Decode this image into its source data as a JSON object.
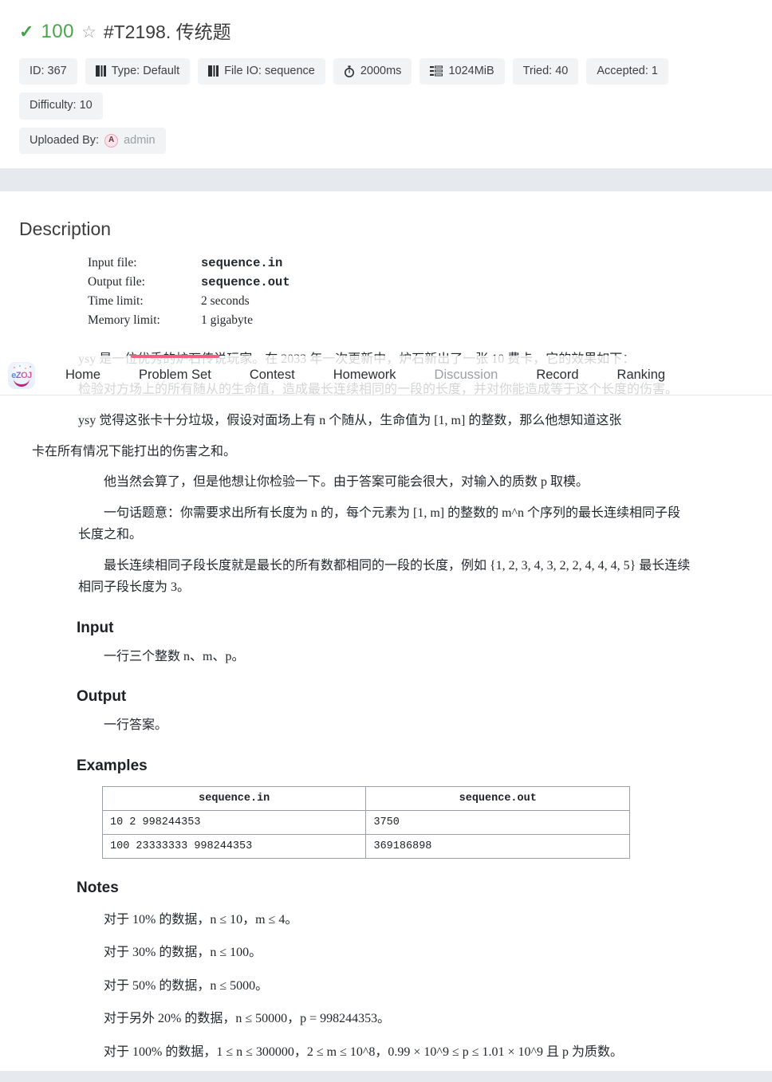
{
  "header": {
    "status_icon": "check-icon",
    "score": "100",
    "star_icon": "star-outline-icon",
    "title": "#T2198. 传统题",
    "badges": [
      {
        "icon": "",
        "label": "ID: 367"
      },
      {
        "icon": "book-icon",
        "label": "Type: Default"
      },
      {
        "icon": "book-icon",
        "label": "File IO: sequence"
      },
      {
        "icon": "stopwatch-icon",
        "label": "2000ms"
      },
      {
        "icon": "memory-icon",
        "label": "1024MiB"
      },
      {
        "icon": "",
        "label": "Tried: 40"
      },
      {
        "icon": "",
        "label": "Accepted: 1"
      },
      {
        "icon": "",
        "label": "Difficulty: 10"
      }
    ],
    "uploader_label": "Uploaded By:",
    "uploader_name": "admin",
    "uploader_avatar_initial": "A"
  },
  "nav": {
    "logo_text": "eZOJ",
    "items": [
      {
        "label": "Home",
        "state": "normal"
      },
      {
        "label": "Problem Set",
        "state": "active"
      },
      {
        "label": "Contest",
        "state": "normal"
      },
      {
        "label": "Homework",
        "state": "normal"
      },
      {
        "label": "Discussion",
        "state": "muted"
      },
      {
        "label": "Record",
        "state": "normal"
      },
      {
        "label": "Ranking",
        "state": "normal"
      }
    ],
    "accent_color": "#f2607f"
  },
  "content": {
    "section_title": "Description",
    "meta": [
      {
        "key": "Input file:",
        "value": "sequence.in",
        "mono": true
      },
      {
        "key": "Output file:",
        "value": "sequence.out",
        "mono": true
      },
      {
        "key": "Time limit:",
        "value": "2 seconds",
        "mono": false
      },
      {
        "key": "Memory limit:",
        "value": "1 gigabyte",
        "mono": false
      }
    ],
    "p1": "ysy 是一位优秀的炉石传说玩家。在 2033 年一次更新中，炉石新出了一张 10 费卡，它的效果如下：",
    "p2_hidden": "检验对方场上的所有随从的生命值，造成最长连续相同的一段的长度，并对你能造成等于这个长度的伤害。",
    "p3_hidden": "ysy 觉得这张卡十分垃圾，假设对面场上有 n 个随从，生命值为 [1, m] 的整数，那么他想知道这张",
    "p4": "卡在所有情况下能打出的伤害之和。",
    "p5": "他当然会算了，但是他想让你检验一下。由于答案可能会很大，对输入的质数 p 取模。",
    "p6": "一句话题意：你需要求出所有长度为 n 的，每个元素为 [1, m] 的整数的 m^n 个序列的最长连续相同子段长度之和。",
    "p7": "最长连续相同子段长度就是最长的所有数都相同的一段的长度，例如 {1, 2, 3, 4, 3, 2, 2, 4, 4, 4, 5} 最长连续相同子段长度为 3。",
    "input_heading": "Input",
    "input_text": "一行三个整数 n、m、p。",
    "output_heading": "Output",
    "output_text": "一行答案。",
    "examples_heading": "Examples",
    "examples": {
      "headers": [
        "sequence.in",
        "sequence.out"
      ],
      "rows": [
        [
          "10 2 998244353",
          "3750"
        ],
        [
          "100  23333333 998244353",
          "369186898"
        ]
      ]
    },
    "notes_heading": "Notes",
    "notes": [
      "对于 10% 的数据，n ≤ 10，m ≤ 4。",
      "对于 30% 的数据，n ≤ 100。",
      "对于 50% 的数据，n ≤ 5000。",
      "对于另外 20% 的数据，n ≤ 50000，p = 998244353。",
      "对于 100% 的数据，1 ≤ n ≤ 300000，2 ≤ m ≤ 10^8，0.99 × 10^9 ≤ p ≤ 1.01 × 10^9 且 p 为质数。"
    ]
  }
}
